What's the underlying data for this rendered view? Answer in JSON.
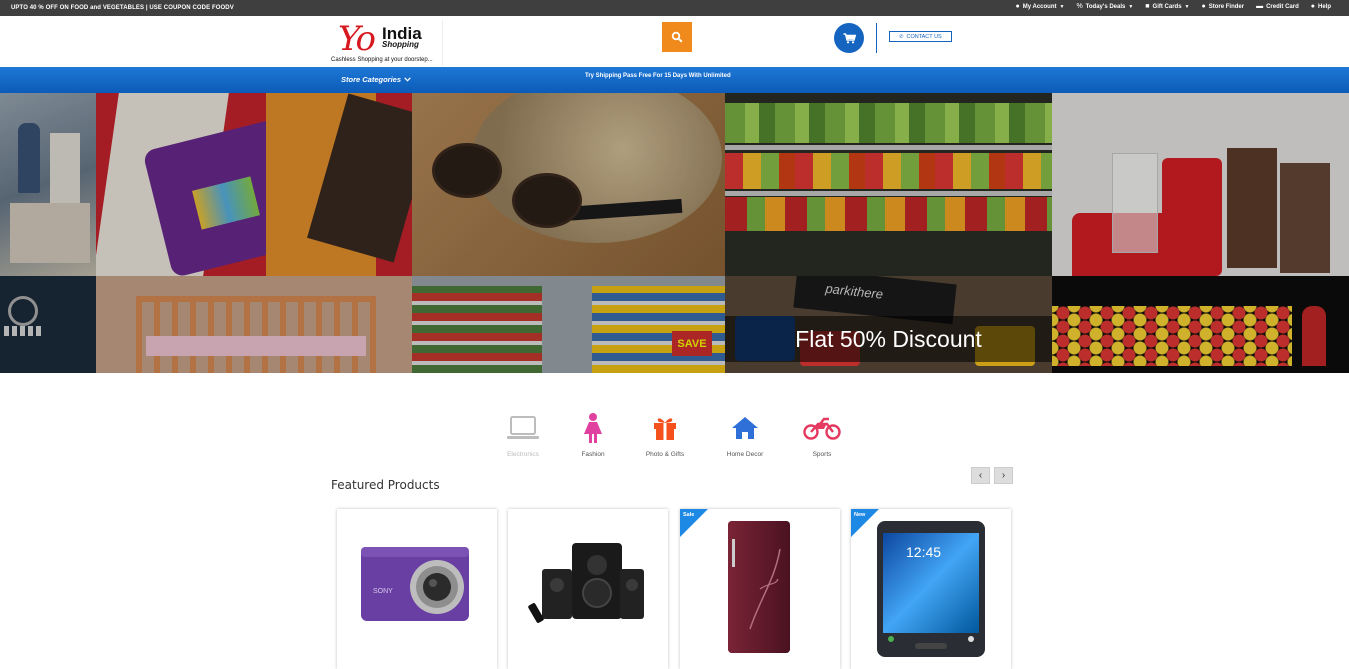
{
  "topbar": {
    "promo": "UPTO 40 % OFF ON FOOD and VEGETABLES | USE COUPON CODE FOODV",
    "links": [
      {
        "label": "My Account",
        "icon": "user-icon",
        "caret": true
      },
      {
        "label": "Today's Deals",
        "icon": "percent-icon",
        "caret": true
      },
      {
        "label": "Gift Cards",
        "icon": "gift-icon",
        "caret": true
      },
      {
        "label": "Store Finder",
        "icon": "map-pin-icon",
        "caret": false
      },
      {
        "label": "Credit Card",
        "icon": "credit-card-icon",
        "caret": false
      },
      {
        "label": "Help",
        "icon": "help-icon",
        "caret": false
      }
    ]
  },
  "header": {
    "logo_yo": "Yo",
    "logo_india": "India",
    "logo_shopping": "Shopping",
    "tagline": "Cashless Shopping at your doorstep...",
    "contact_label": "CONTACT US"
  },
  "nav": {
    "categories_label": "Store Categories",
    "shipping_text": "Try Shipping Pass Free For 15 Days With Unlimited"
  },
  "hero": {
    "banner_text": "Flat 50% Discount"
  },
  "categories": [
    {
      "label": "Electronics",
      "icon": "laptop-icon",
      "color": "#bdbdbd",
      "active": false
    },
    {
      "label": "Fashion",
      "icon": "woman-icon",
      "color": "#e040a0",
      "active": true
    },
    {
      "label": "Photo & Gifts",
      "icon": "gift-icon",
      "color": "#f4511e",
      "active": true
    },
    {
      "label": "Home Decor",
      "icon": "home-icon",
      "color": "#2f6fd8",
      "active": true
    },
    {
      "label": "Sports",
      "icon": "motorbike-icon",
      "color": "#e53960",
      "active": true
    }
  ],
  "featured": {
    "title": "Featured Products",
    "prev": "‹",
    "next": "›"
  },
  "products": [
    {
      "badge": "",
      "image": "camera"
    },
    {
      "badge": "",
      "image": "speakers"
    },
    {
      "badge": "Sale",
      "image": "refrigerator"
    },
    {
      "badge": "New",
      "image": "tablet"
    }
  ],
  "colors": {
    "topbar": "#3f3f3f",
    "nav_blue": "#1565c0",
    "search_orange": "#f08a1c",
    "logo_red": "#d71920"
  }
}
